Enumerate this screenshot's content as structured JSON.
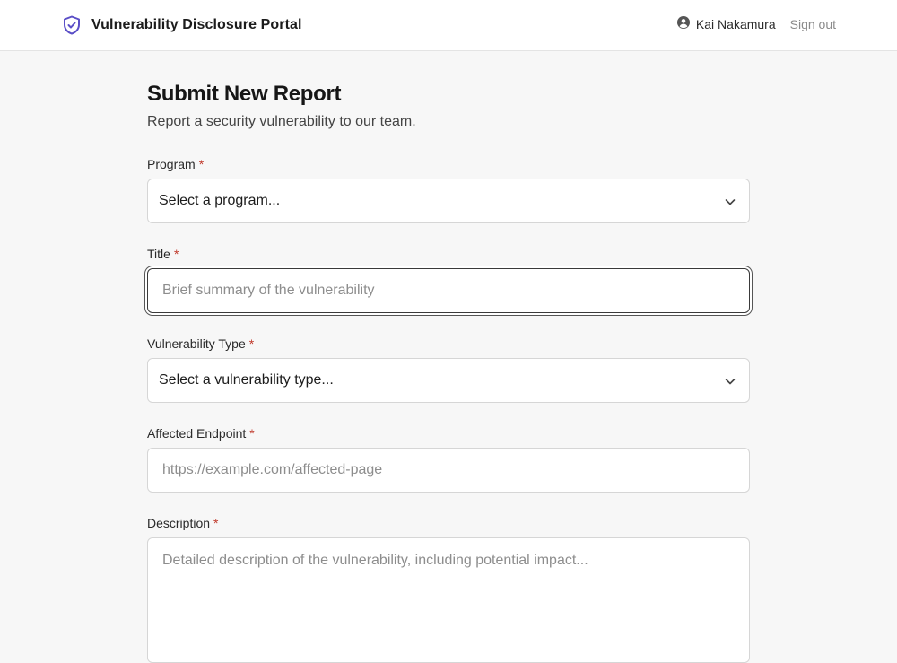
{
  "header": {
    "brand_icon": "shield-check-icon",
    "title": "Vulnerability Disclosure Portal",
    "user_icon": "user-circle-icon",
    "user_name": "Kai Nakamura",
    "sign_out": "Sign out",
    "accent_color": "#5b4fc7"
  },
  "page": {
    "title": "Submit New Report",
    "subtitle": "Report a security vulnerability to our team."
  },
  "form": {
    "required_marker": "*",
    "program": {
      "label": "Program",
      "value": "Select a program..."
    },
    "title": {
      "label": "Title",
      "placeholder": "Brief summary of the vulnerability"
    },
    "vuln_type": {
      "label": "Vulnerability Type",
      "value": "Select a vulnerability type..."
    },
    "endpoint": {
      "label": "Affected Endpoint",
      "placeholder": "https://example.com/affected-page"
    },
    "description": {
      "label": "Description",
      "placeholder": "Detailed description of the vulnerability, including potential impact..."
    }
  }
}
